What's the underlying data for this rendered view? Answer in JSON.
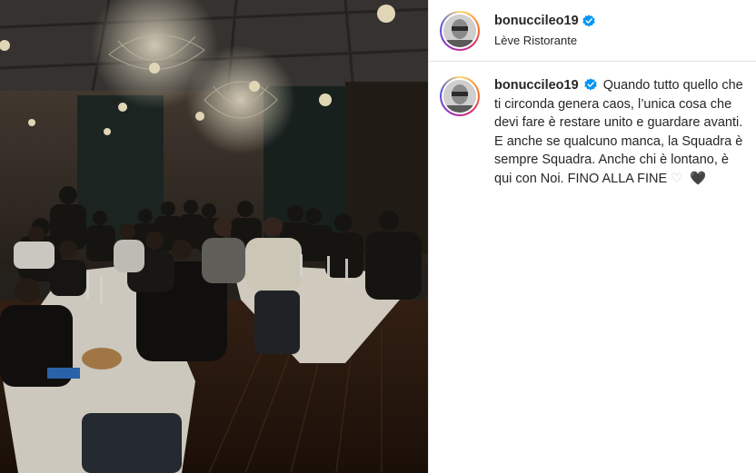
{
  "post": {
    "username": "bonuccileo19",
    "location": "Lève Ristorante",
    "caption": "Quando tutto quello che ti circonda genera caos, l’unica cosa che devi fare è restare unito e guardare avanti. E anche se qualcuno manca, la Squadra è sempre Squadra. Anche chi è lontano, è qui con Noi. FINO ALLA FINE",
    "caption_emojis": {
      "white_heart": "♡",
      "black_heart": "🖤"
    }
  },
  "icons": {
    "verified": "verified-badge-icon",
    "avatar": "profile-avatar"
  },
  "colors": {
    "verified_blue": "#0095f6",
    "text": "#262626",
    "divider": "#e3e3e3"
  }
}
